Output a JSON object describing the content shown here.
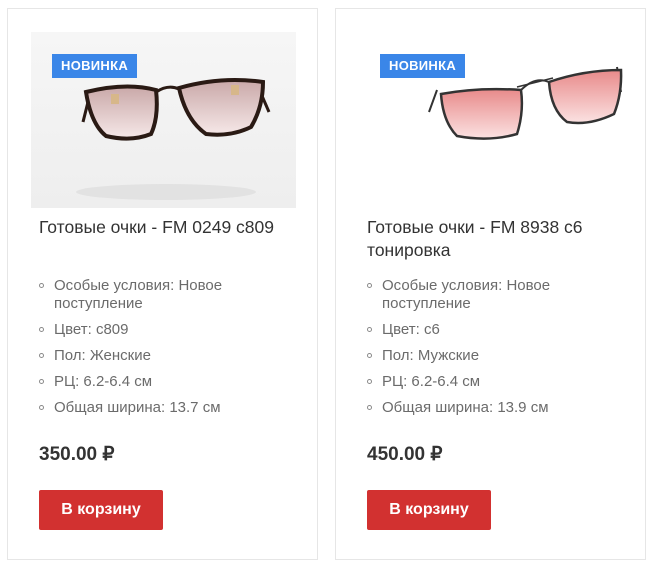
{
  "products": [
    {
      "badge": "НОВИНКА",
      "title": "Готовые очки - FM 0249 c809",
      "specs": [
        "Особые условия: Новое поступление",
        "Цвет: c809",
        "Пол: Женские",
        "РЦ: 6.2-6.4 см",
        "Общая ширина: 13.7 см"
      ],
      "price": "350.00 ₽",
      "button_label": "В корзину",
      "image_icon": "glasses-icon"
    },
    {
      "badge": "НОВИНКА",
      "title": "Готовые очки - FM 8938 c6 тонировка",
      "specs": [
        "Особые условия: Новое поступление",
        "Цвет: c6",
        "Пол: Мужские",
        "РЦ: 6.2-6.4 см",
        "Общая ширина: 13.9 см"
      ],
      "price": "450.00 ₽",
      "button_label": "В корзину",
      "image_icon": "glasses-icon"
    }
  ],
  "colors": {
    "badge_bg": "#3a86e8",
    "button_bg": "#d23130",
    "lens_tint_pink": "#f0b4b4"
  }
}
